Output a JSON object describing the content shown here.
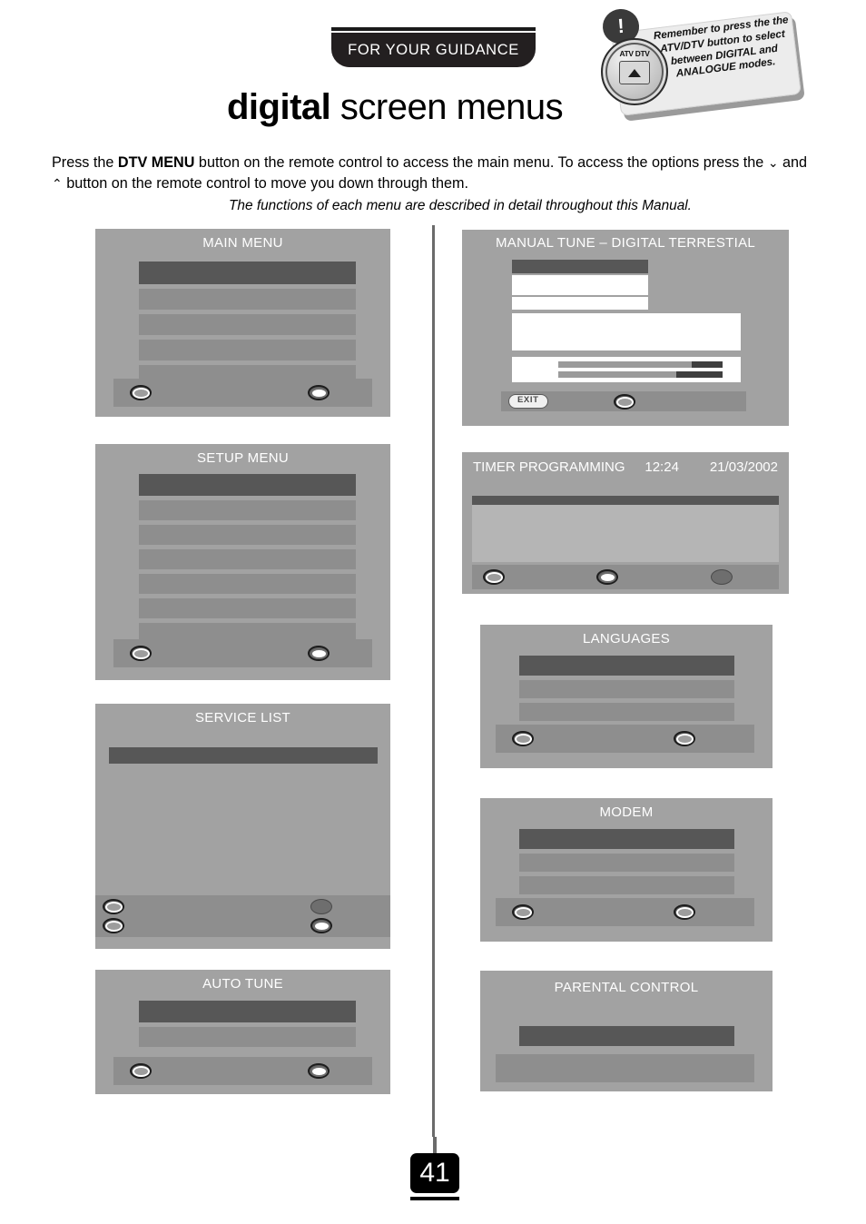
{
  "header": {
    "guidance_tab": "FOR YOUR GUIDANCE",
    "title_bold": "digital",
    "title_rest": " screen menus"
  },
  "badge": {
    "exclaim": "!",
    "knob_label": "ATV DTV",
    "note_text": "Remember to press the the ATV/DTV button to select between DIGITAL and ANALOGUE modes."
  },
  "intro": {
    "line1_a": "Press the ",
    "line1_bold": "DTV MENU",
    "line1_b": " button on the remote control to access the main menu. To access the options press the ",
    "down_arrow": "⌄",
    "line1_c": " and ",
    "up_arrow": "⌃",
    "line1_d": " button on the remote control to move you down through them.",
    "note": "The functions of each menu are described in detail throughout this Manual."
  },
  "screens": {
    "main_menu": {
      "title": "MAIN MENU",
      "rows": 5
    },
    "setup_menu": {
      "title": "SETUP MENU",
      "rows": 7
    },
    "service_list": {
      "title": "SERVICE LIST",
      "rows": 1
    },
    "auto_tune": {
      "title": "AUTO TUNE",
      "rows": 2
    },
    "manual_tune": {
      "title": "MANUAL TUNE – DIGITAL TERRESTIAL",
      "exit_label": "EXIT"
    },
    "timer_programming": {
      "title": "TIMER PROGRAMMING",
      "time": "12:24",
      "date": "21/03/2002"
    },
    "languages": {
      "title": "LANGUAGES",
      "rows": 3
    },
    "modem": {
      "title": "MODEM",
      "rows": 3
    },
    "parental_control": {
      "title": "PARENTAL CONTROL",
      "rows": 1
    }
  },
  "footer": {
    "page_number": "41"
  },
  "colors": {
    "screen_bg": "#a2a2a2",
    "row": "#8e8e8e",
    "row_selected": "#575757",
    "row_white": "#ffffff",
    "panel": "#b5b5b5",
    "tab_black": "#231f20"
  }
}
